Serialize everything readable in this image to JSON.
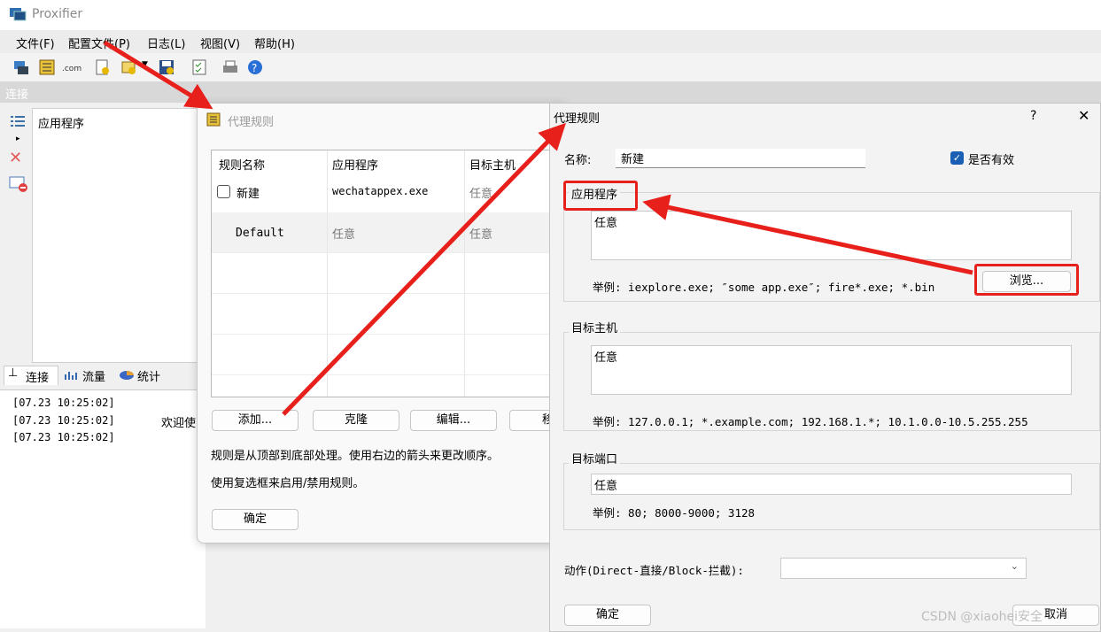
{
  "app": {
    "title": "Proxifier",
    "menu": [
      "文件(F)",
      "配置文件(P)",
      "日志(L)",
      "视图(V)",
      "帮助(H)"
    ],
    "section_header": "连接",
    "app_list_header": "应用程序",
    "bottom_tabs": [
      "连接",
      "流量",
      "统计"
    ],
    "log_lines": [
      "[07.23 10:25:02]",
      "[07.23 10:25:02]",
      "[07.23 10:25:02]"
    ],
    "welcome_text": "欢迎使"
  },
  "rules_dialog": {
    "title": "代理规则",
    "columns": [
      "规则名称",
      "应用程序",
      "目标主机"
    ],
    "rows": [
      {
        "name": "新建",
        "app": "wechatappex.exe",
        "host": "任意"
      },
      {
        "name": "Default",
        "app": "任意",
        "host": "任意"
      }
    ],
    "buttons": [
      "添加...",
      "克隆",
      "编辑...",
      "移"
    ],
    "info1": "规则是从顶部到底部处理。使用右边的箭头来更改顺序。",
    "info2": "使用复选框来启用/禁用规则。",
    "ok": "确定"
  },
  "rule_edit": {
    "title": "代理规则",
    "help": "?",
    "close": "✕",
    "name_label": "名称:",
    "name_value": "新建",
    "enabled_label": "是否有效",
    "enabled": true,
    "app_group": "应用程序",
    "app_value": "任意",
    "app_example": "举例: iexplore.exe; ″some app.exe″; fire*.exe; *.bin",
    "browse": "浏览...",
    "host_group": "目标主机",
    "host_value": "任意",
    "host_example": "举例: 127.0.0.1; *.example.com; 192.168.1.*; 10.1.0.0-10.5.255.255",
    "port_group": "目标端口",
    "port_value": "任意",
    "port_example": "举例: 80; 8000-9000; 3128",
    "action_label": "动作(Direct-直接/Block-拦截):",
    "action_value": "",
    "ok": "确定",
    "cancel": "取消"
  },
  "watermark": "CSDN @xiaohei安全",
  "colors": {
    "highlight": "#e8201c",
    "checkbox": "#1a5fb4"
  }
}
